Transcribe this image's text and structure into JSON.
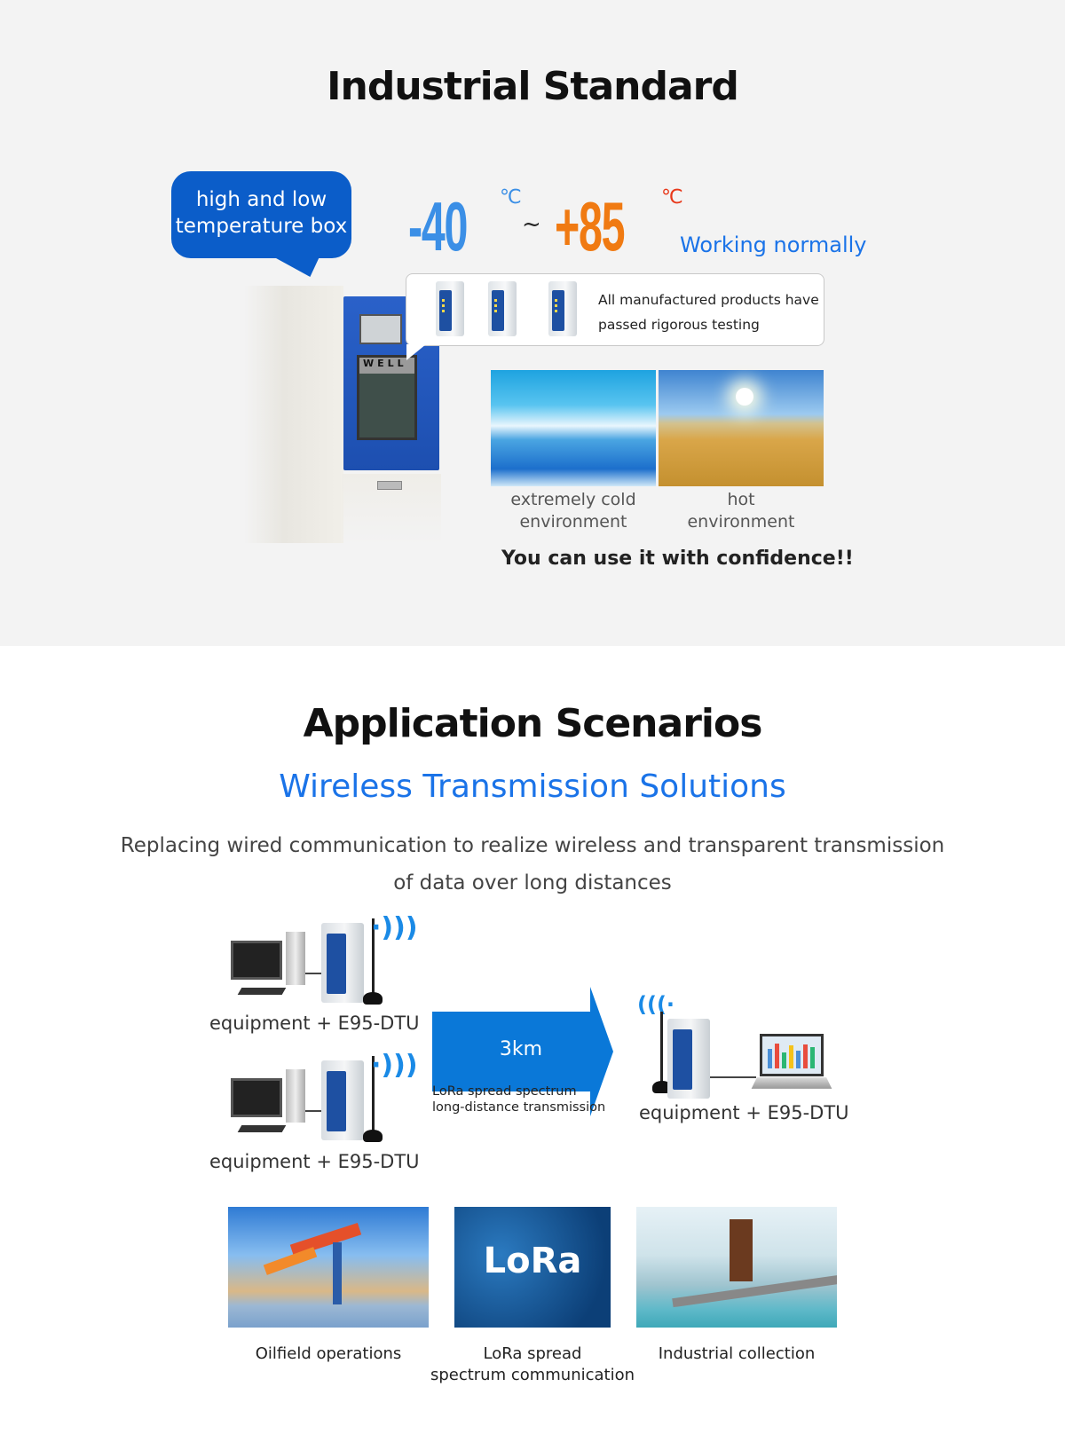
{
  "industrial": {
    "title": "Industrial Standard",
    "bubble_line1": "high and low",
    "bubble_line2": "temperature box",
    "temp_low": "-40",
    "temp_high": "+85",
    "temp_unit": "℃",
    "separator": "~",
    "status": "Working normally",
    "testing_line1": "All manufactured products have",
    "testing_line2": "passed rigorous testing",
    "cold_label_line1": "extremely cold",
    "cold_label_line2": "environment",
    "hot_label_line1": "hot",
    "hot_label_line2": "environment",
    "confidence": "You can use it with confidence!!",
    "chamber_brand": "WELL"
  },
  "application": {
    "title": "Application Scenarios",
    "subtitle": "Wireless Transmission Solutions",
    "desc_line1": "Replacing wired communication to realize wireless and transparent transmission",
    "desc_line2": "of data over long distances",
    "node_label": "equipment + E95-DTU",
    "distance": "3km",
    "caption_line1": "LoRa spread spectrum",
    "caption_line2": "long-distance transmission",
    "scenarios": [
      {
        "label_line1": "Oilfield operations",
        "label_line2": ""
      },
      {
        "label_line1": "LoRa spread",
        "label_line2": "spectrum communication",
        "image_text": "LoRa"
      },
      {
        "label_line1": "Industrial collection",
        "label_line2": ""
      }
    ]
  },
  "colors": {
    "accent_blue": "#1a73e8",
    "bubble_blue": "#0b5dc9",
    "arrow_blue": "#0a78d8",
    "cold": "#3b8fe6",
    "hot": "#f07a12"
  }
}
